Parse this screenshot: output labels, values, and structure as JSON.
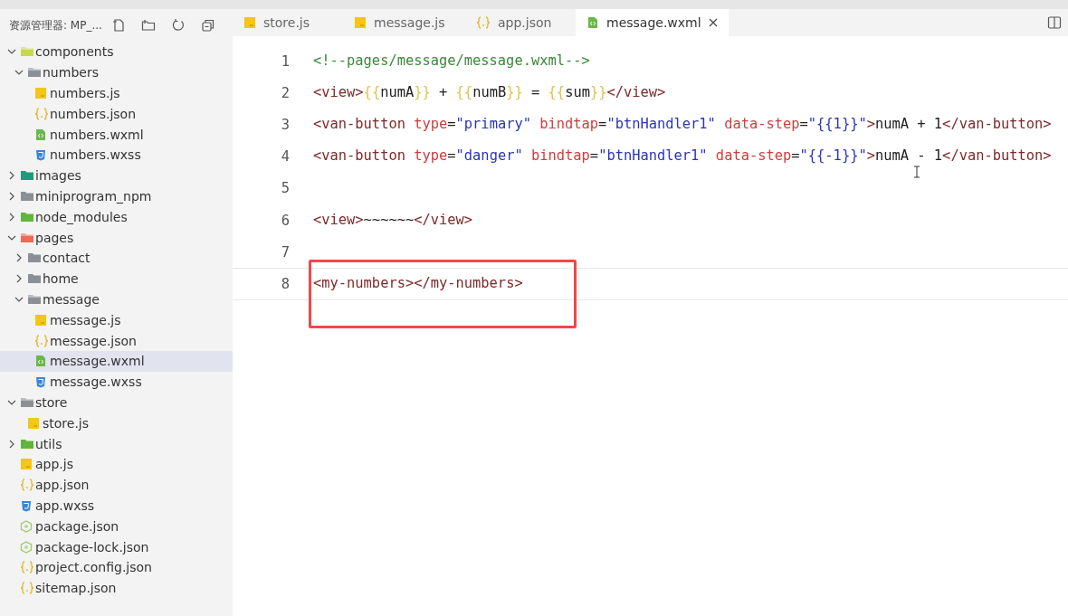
{
  "explorer": {
    "title": "资源管理器: MP_...",
    "tree": [
      {
        "label": "components",
        "kind": "folder",
        "color": "#c8d84a",
        "expanded": true,
        "selected": false,
        "children": [
          {
            "label": "numbers",
            "kind": "folder",
            "color": "#8a9096",
            "expanded": true,
            "selected": false,
            "children": [
              {
                "label": "numbers.js",
                "kind": "js",
                "selected": false
              },
              {
                "label": "numbers.json",
                "kind": "json",
                "selected": false
              },
              {
                "label": "numbers.wxml",
                "kind": "wxml",
                "selected": false
              },
              {
                "label": "numbers.wxss",
                "kind": "wxss",
                "selected": false
              }
            ]
          }
        ]
      },
      {
        "label": "images",
        "kind": "folder",
        "color": "#1f9b7c",
        "expanded": false,
        "selected": false
      },
      {
        "label": "miniprogram_npm",
        "kind": "folder",
        "color": "#8a9096",
        "expanded": false,
        "selected": false
      },
      {
        "label": "node_modules",
        "kind": "folder",
        "color": "#5fb63a",
        "expanded": false,
        "selected": false
      },
      {
        "label": "pages",
        "kind": "folder",
        "color": "#ef6a55",
        "expanded": true,
        "selected": false,
        "children": [
          {
            "label": "contact",
            "kind": "folder",
            "color": "#8a9096",
            "expanded": false,
            "selected": false
          },
          {
            "label": "home",
            "kind": "folder",
            "color": "#8a9096",
            "expanded": false,
            "selected": false
          },
          {
            "label": "message",
            "kind": "folder",
            "color": "#8a9096",
            "expanded": true,
            "selected": false,
            "children": [
              {
                "label": "message.js",
                "kind": "js",
                "selected": false
              },
              {
                "label": "message.json",
                "kind": "json",
                "selected": false
              },
              {
                "label": "message.wxml",
                "kind": "wxml",
                "selected": true
              },
              {
                "label": "message.wxss",
                "kind": "wxss",
                "selected": false
              }
            ]
          }
        ]
      },
      {
        "label": "store",
        "kind": "folder",
        "color": "#8a9096",
        "expanded": true,
        "selected": false,
        "children": [
          {
            "label": "store.js",
            "kind": "js",
            "selected": false
          }
        ]
      },
      {
        "label": "utils",
        "kind": "folder",
        "color": "#5fb63a",
        "expanded": false,
        "selected": false
      },
      {
        "label": "app.js",
        "kind": "js",
        "selected": false
      },
      {
        "label": "app.json",
        "kind": "json",
        "selected": false
      },
      {
        "label": "app.wxss",
        "kind": "wxss",
        "selected": false
      },
      {
        "label": "package.json",
        "kind": "npm",
        "selected": false
      },
      {
        "label": "package-lock.json",
        "kind": "npm",
        "selected": false
      },
      {
        "label": "project.config.json",
        "kind": "json",
        "selected": false
      },
      {
        "label": "sitemap.json",
        "kind": "json",
        "selected": false
      }
    ]
  },
  "tabs": [
    {
      "label": "store.js",
      "kind": "js",
      "selected": false
    },
    {
      "label": "message.js",
      "kind": "js",
      "selected": false
    },
    {
      "label": "app.json",
      "kind": "json",
      "selected": false
    },
    {
      "label": "message.wxml",
      "kind": "wxml",
      "selected": true
    }
  ],
  "editor": {
    "lines": [
      {
        "number": "1",
        "current": false,
        "boxed": false,
        "tokens": [
          {
            "kind": "comment",
            "text": "<!--pages/message/message.wxml-->"
          }
        ]
      },
      {
        "number": "2",
        "current": false,
        "boxed": false,
        "tokens": [
          {
            "kind": "tag",
            "text": "<view>"
          },
          {
            "kind": "brace",
            "text": "{{"
          },
          {
            "kind": "text",
            "text": "numA"
          },
          {
            "kind": "brace",
            "text": "}}"
          },
          {
            "kind": "text",
            "text": " + "
          },
          {
            "kind": "brace",
            "text": "{{"
          },
          {
            "kind": "text",
            "text": "numB"
          },
          {
            "kind": "brace",
            "text": "}}"
          },
          {
            "kind": "text",
            "text": " = "
          },
          {
            "kind": "brace",
            "text": "{{"
          },
          {
            "kind": "text",
            "text": "sum"
          },
          {
            "kind": "brace",
            "text": "}}"
          },
          {
            "kind": "tag",
            "text": "</view>"
          }
        ]
      },
      {
        "number": "3",
        "current": false,
        "boxed": false,
        "tokens": [
          {
            "kind": "tag",
            "text": "<van-button"
          },
          {
            "kind": "attr",
            "text": " type"
          },
          {
            "kind": "text",
            "text": "="
          },
          {
            "kind": "str",
            "text": "\"primary\""
          },
          {
            "kind": "attr",
            "text": " bindtap"
          },
          {
            "kind": "text",
            "text": "="
          },
          {
            "kind": "str",
            "text": "\"btnHandler1\""
          },
          {
            "kind": "attr",
            "text": " data-step"
          },
          {
            "kind": "text",
            "text": "="
          },
          {
            "kind": "str",
            "text": "\"{{1}}\""
          },
          {
            "kind": "tag",
            "text": ">"
          },
          {
            "kind": "text",
            "text": "numA + 1"
          },
          {
            "kind": "tag",
            "text": "</van-button>"
          }
        ]
      },
      {
        "number": "4",
        "current": false,
        "boxed": false,
        "tokens": [
          {
            "kind": "tag",
            "text": "<van-button"
          },
          {
            "kind": "attr",
            "text": " type"
          },
          {
            "kind": "text",
            "text": "="
          },
          {
            "kind": "str",
            "text": "\"danger\""
          },
          {
            "kind": "attr",
            "text": " bindtap"
          },
          {
            "kind": "text",
            "text": "="
          },
          {
            "kind": "str",
            "text": "\"btnHandler1\""
          },
          {
            "kind": "attr",
            "text": " data-step"
          },
          {
            "kind": "text",
            "text": "="
          },
          {
            "kind": "str",
            "text": "\"{{-1}}\""
          },
          {
            "kind": "tag",
            "text": ">"
          },
          {
            "kind": "text",
            "text": "numA - 1"
          },
          {
            "kind": "tag",
            "text": "</van-button>"
          }
        ]
      },
      {
        "number": "5",
        "current": false,
        "boxed": false
      },
      {
        "number": "6",
        "current": false,
        "boxed": false,
        "tokens": [
          {
            "kind": "tag",
            "text": "<view>"
          },
          {
            "kind": "text",
            "text": "~~~~~~"
          },
          {
            "kind": "tag",
            "text": "</view>"
          }
        ]
      },
      {
        "number": "7",
        "current": false,
        "boxed": false
      },
      {
        "number": "8",
        "current": true,
        "boxed": true,
        "tokens": [
          {
            "kind": "tag",
            "text": "<my-numbers>"
          },
          {
            "kind": "tag",
            "text": "</my-numbers>"
          }
        ]
      }
    ]
  }
}
